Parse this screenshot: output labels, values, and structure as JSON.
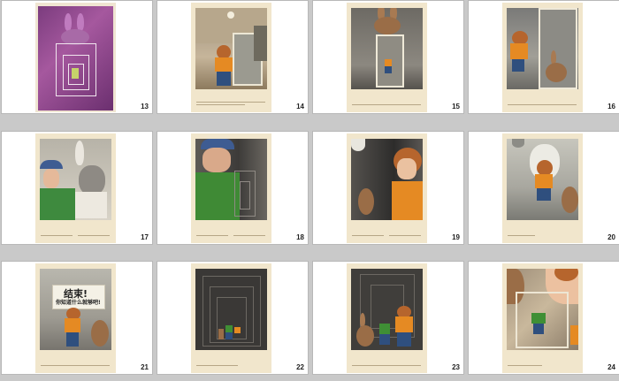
{
  "slides": [
    {
      "number": "13"
    },
    {
      "number": "14"
    },
    {
      "number": "15"
    },
    {
      "number": "16"
    },
    {
      "number": "17"
    },
    {
      "number": "18"
    },
    {
      "number": "19"
    },
    {
      "number": "20"
    },
    {
      "number": "21",
      "speech_line1": "结束!",
      "speech_line2": "你知道什么就够吧!"
    },
    {
      "number": "22"
    },
    {
      "number": "23"
    },
    {
      "number": "24"
    }
  ]
}
